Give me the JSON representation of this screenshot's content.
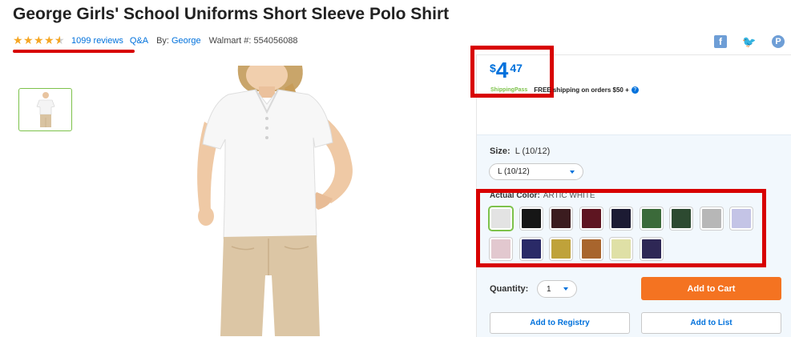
{
  "product": {
    "title": "George Girls' School Uniforms Short Sleeve Polo Shirt",
    "rating": 4.5,
    "reviews_link": "1099 reviews",
    "qa_link": "Q&A",
    "by_label": "By:",
    "brand_link": "George",
    "walmart_number": "Walmart #: 554056088"
  },
  "share": {
    "facebook_icon": "f",
    "twitter_icon": "🐦",
    "pinterest_icon": "P"
  },
  "price": {
    "currency": "$",
    "dollars": "4",
    "cents": "47",
    "shipping_pass": "ShippingPass",
    "free_shipping": "FREE shipping on orders $50 +",
    "help_icon": "?"
  },
  "size": {
    "label": "Size:",
    "value": "L (10/12)",
    "select_value": "L (10/12)"
  },
  "color": {
    "label": "Actual Color:",
    "value": "ARTIC WHITE",
    "swatches": [
      {
        "name": "artic-white",
        "hex": "#e3e3e3",
        "selected": true
      },
      {
        "name": "black",
        "hex": "#161616",
        "selected": false
      },
      {
        "name": "dark-brown",
        "hex": "#3b1c1f",
        "selected": false
      },
      {
        "name": "burgundy",
        "hex": "#5e1521",
        "selected": false
      },
      {
        "name": "navy",
        "hex": "#1c1b33",
        "selected": false
      },
      {
        "name": "kelly-green",
        "hex": "#3b6a3a",
        "selected": false
      },
      {
        "name": "hunter-green",
        "hex": "#2d4a31",
        "selected": false
      },
      {
        "name": "heather-grey",
        "hex": "#b7b7b7",
        "selected": false
      },
      {
        "name": "lavender",
        "hex": "#c4c4e6",
        "selected": false
      },
      {
        "name": "light-pink",
        "hex": "#e2c8cf",
        "selected": false
      },
      {
        "name": "royal-navy",
        "hex": "#2a2a67",
        "selected": false
      },
      {
        "name": "gold",
        "hex": "#bfa23a",
        "selected": false
      },
      {
        "name": "copper",
        "hex": "#a8652d",
        "selected": false
      },
      {
        "name": "light-yellow",
        "hex": "#dfe0a6",
        "selected": false
      },
      {
        "name": "purple",
        "hex": "#2e2755",
        "selected": false
      }
    ]
  },
  "quantity": {
    "label": "Quantity:",
    "value": "1"
  },
  "actions": {
    "add_to_cart": "Add to Cart",
    "add_to_registry": "Add to Registry",
    "add_to_list": "Add to List"
  },
  "colors": {
    "link_blue": "#0071dc",
    "cart_orange": "#f47321",
    "highlight_red": "#d80000",
    "star_gold": "#f5a623"
  }
}
